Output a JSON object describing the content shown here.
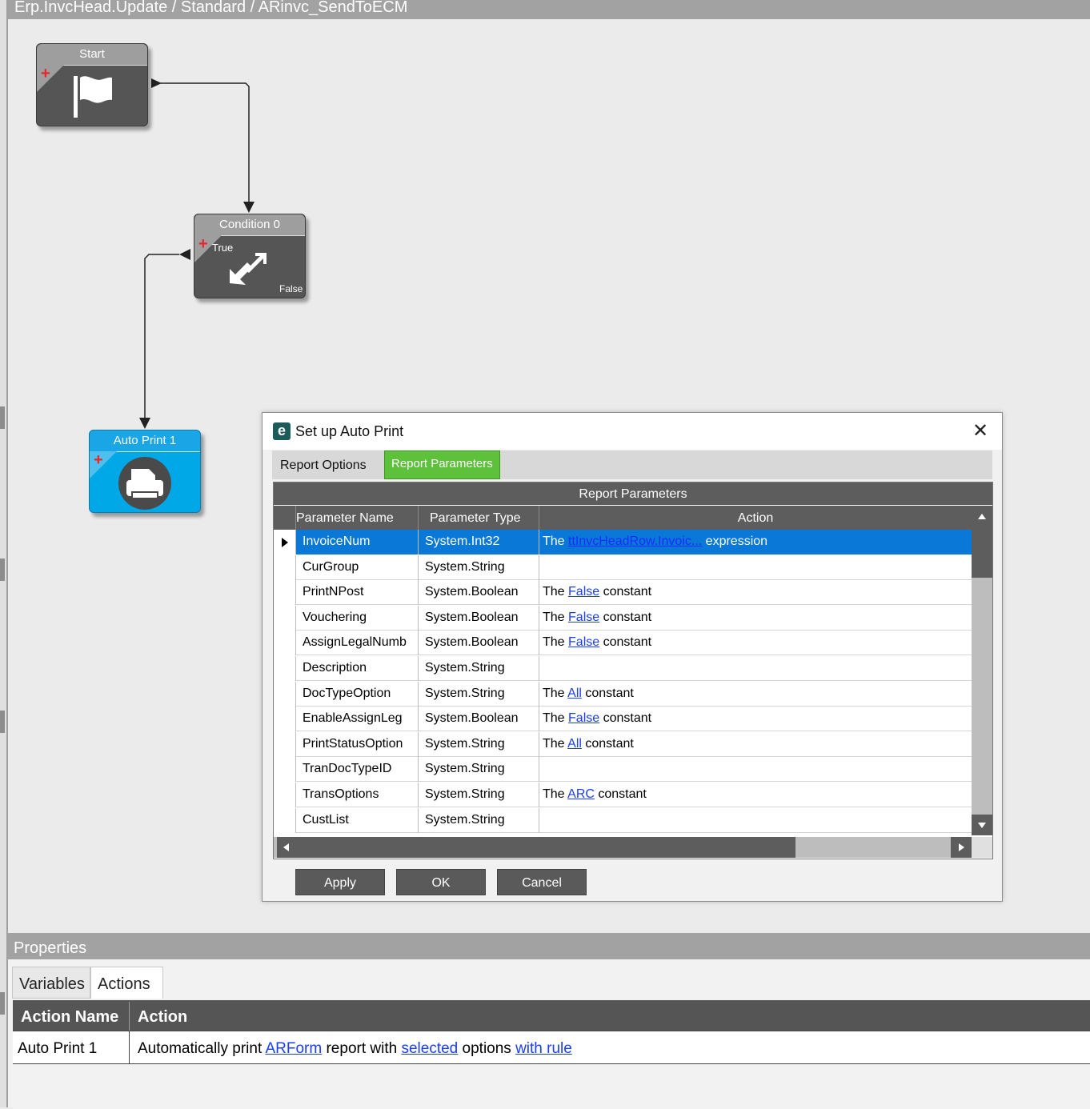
{
  "window": {
    "breadcrumb": "Erp.InvcHead.Update / Standard / ARinvc_SendToECM"
  },
  "workflow": {
    "nodes": [
      {
        "title": "Start",
        "icon": "flag-icon"
      },
      {
        "title": "Condition 0",
        "icon": "condition-arrows-icon",
        "true_label": "True",
        "false_label": "False"
      },
      {
        "title": "Auto Print 1",
        "icon": "printer-icon"
      }
    ]
  },
  "dialog": {
    "title": "Set up Auto Print",
    "tabs": [
      "Report Options",
      "Report Parameters"
    ],
    "active_tab": "Report Parameters",
    "grid": {
      "caption": "Report Parameters",
      "columns": [
        "Parameter Name",
        "Parameter Type",
        "Action"
      ],
      "rows": [
        {
          "name": "InvoiceNum",
          "type": "System.Int32",
          "prefix": "The",
          "link": "ttInvcHeadRow.Invoic...",
          "suffix": "expression",
          "selected": true
        },
        {
          "name": "CurGroup",
          "type": "System.String",
          "prefix": "",
          "link": "",
          "suffix": ""
        },
        {
          "name": "PrintNPost",
          "type": "System.Boolean",
          "prefix": "The",
          "link": "False",
          "suffix": "constant"
        },
        {
          "name": "Vouchering",
          "type": "System.Boolean",
          "prefix": "The",
          "link": "False",
          "suffix": "constant"
        },
        {
          "name": "AssignLegalNumb",
          "type": "System.Boolean",
          "prefix": "The",
          "link": "False",
          "suffix": "constant"
        },
        {
          "name": "Description",
          "type": "System.String",
          "prefix": "",
          "link": "",
          "suffix": ""
        },
        {
          "name": "DocTypeOption",
          "type": "System.String",
          "prefix": "The",
          "link": "All",
          "suffix": "constant"
        },
        {
          "name": "EnableAssignLeg",
          "type": "System.Boolean",
          "prefix": "The",
          "link": "False",
          "suffix": "constant"
        },
        {
          "name": "PrintStatusOption",
          "type": "System.String",
          "prefix": "The",
          "link": "All",
          "suffix": "constant"
        },
        {
          "name": "TranDocTypeID",
          "type": "System.String",
          "prefix": "",
          "link": "",
          "suffix": ""
        },
        {
          "name": "TransOptions",
          "type": "System.String",
          "prefix": "The",
          "link": "ARC",
          "suffix": "constant"
        },
        {
          "name": "CustList",
          "type": "System.String",
          "prefix": "",
          "link": "",
          "suffix": ""
        }
      ]
    },
    "buttons": {
      "apply": "Apply",
      "ok": "OK",
      "cancel": "Cancel"
    }
  },
  "properties": {
    "title": "Properties",
    "tabs": [
      "Variables",
      "Actions"
    ],
    "active_tab": "Actions",
    "table": {
      "columns": [
        "Action Name",
        "Action"
      ],
      "rows": [
        {
          "name": "Auto Print 1",
          "parts": [
            {
              "text": "Automatically print ",
              "link": false
            },
            {
              "text": "ARForm",
              "link": true
            },
            {
              "text": " report with ",
              "link": false
            },
            {
              "text": "selected",
              "link": true
            },
            {
              "text": " options ",
              "link": false
            },
            {
              "text": "with rule",
              "link": true
            }
          ]
        }
      ]
    }
  }
}
